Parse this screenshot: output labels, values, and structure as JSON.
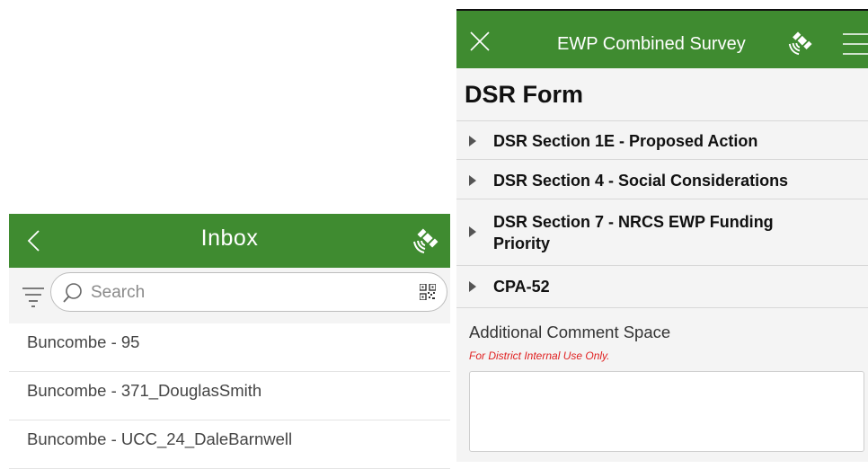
{
  "inbox": {
    "title": "Inbox",
    "search_placeholder": "Search",
    "items": [
      {
        "label": "Buncombe - 95"
      },
      {
        "label": "Buncombe - 371_DouglasSmith"
      },
      {
        "label": "Buncombe - UCC_24_DaleBarnwell"
      }
    ]
  },
  "survey": {
    "title": "EWP Combined Survey",
    "form_title": "DSR Form",
    "sections": [
      {
        "label": "DSR Section 1E - Proposed Action"
      },
      {
        "label": "DSR Section 4 - Social Considerations"
      },
      {
        "label": "DSR Section 7 - NRCS EWP Funding Priority"
      },
      {
        "label": "CPA-52"
      }
    ],
    "comment_label": "Additional Comment Space",
    "comment_hint": "For District Internal Use Only.",
    "comment_value": ""
  },
  "colors": {
    "header_green": "#3f8b30",
    "hint_red": "#e02020"
  },
  "icons": [
    "back-chevron-icon",
    "satellite-icon",
    "filter-icon",
    "search-icon",
    "qr-code-icon",
    "close-icon",
    "menu-icon",
    "expand-triangle-icon"
  ]
}
